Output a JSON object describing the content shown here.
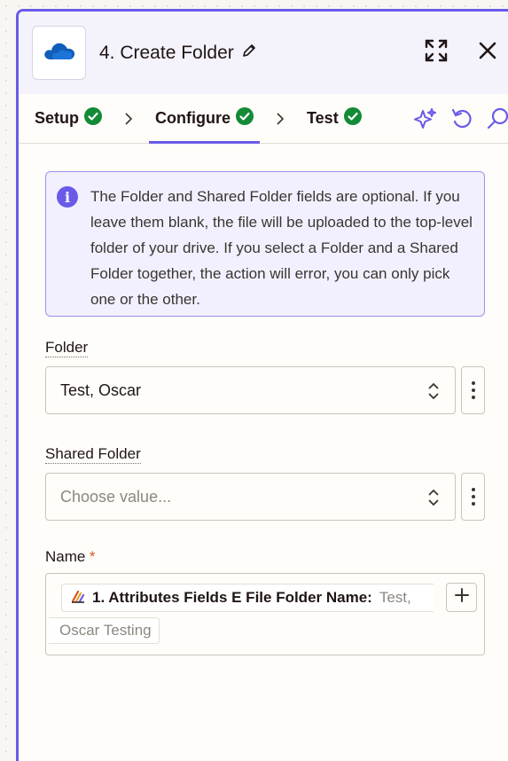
{
  "header": {
    "title": "4. Create Folder",
    "app_icon": "onedrive-cloud-icon",
    "accent": "#695be8"
  },
  "tabs": [
    {
      "label": "Setup",
      "status": "complete"
    },
    {
      "label": "Configure",
      "status": "complete",
      "active": true
    },
    {
      "label": "Test",
      "status": "complete"
    }
  ],
  "info": {
    "text": "The Folder and Shared Folder fields are optional. If you leave them blank, the file will be uploaded to the top-level folder of your drive. If you select a Folder and a Shared Folder together, the action will error, you can only pick one or the other."
  },
  "fields": {
    "folder": {
      "label": "Folder",
      "value": "Test, Oscar"
    },
    "shared_folder": {
      "label": "Shared Folder",
      "placeholder": "Choose value..."
    },
    "name": {
      "label": "Name",
      "required_mark": "*",
      "token_label": "1. Attributes Fields E File Folder Name:",
      "token_value_start": "Test,",
      "token_value_end": "Oscar Testing"
    }
  },
  "colors": {
    "success": "#138a36",
    "required": "#d8561f"
  }
}
